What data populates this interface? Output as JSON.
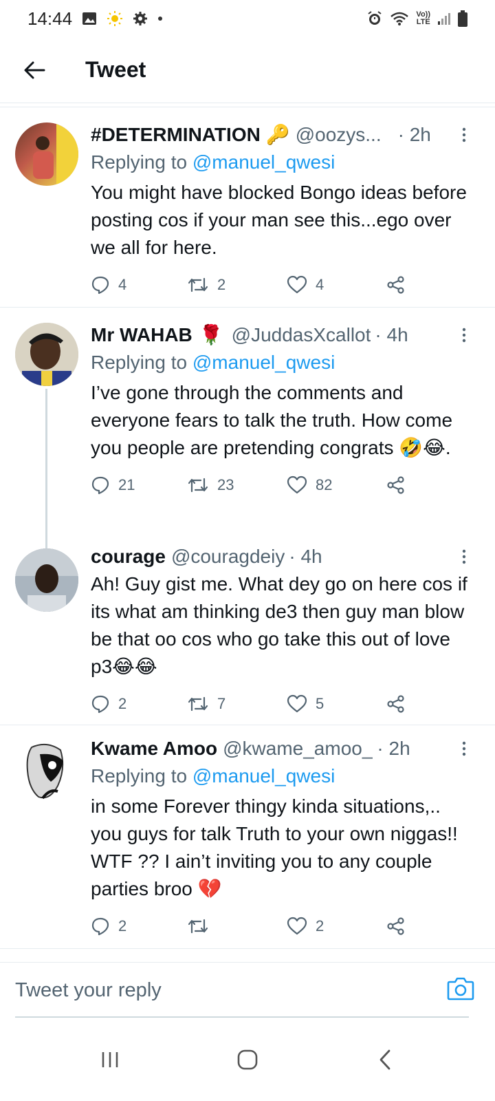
{
  "status_bar": {
    "time": "14:44",
    "icons_left": [
      "image-icon",
      "sun-icon",
      "gear-icon",
      "dot-icon"
    ],
    "icons_right": [
      "alarm-icon",
      "wifi-icon",
      "volte-icon",
      "signal-icon",
      "battery-icon"
    ],
    "volte_label_top": "Vo))",
    "volte_label_bottom": "LTE"
  },
  "header": {
    "title": "Tweet"
  },
  "tweets": [
    {
      "name": "#DETERMINATION",
      "name_emoji": "🔑",
      "handle": "@oozys...",
      "time": "· 2h",
      "replying_prefix": "Replying to ",
      "replying_to": "@manuel_qwesi",
      "text": "You might have blocked Bongo ideas before posting cos if your man see this...ego over we all for here.",
      "replies": "4",
      "retweets": "2",
      "likes": "4"
    },
    {
      "name": "Mr WAHAB",
      "name_emoji": "🌹",
      "handle": "@JuddasXcallot",
      "time": "· 4h",
      "replying_prefix": "Replying to ",
      "replying_to": "@manuel_qwesi",
      "text": "I’ve gone through the comments and everyone fears to talk the truth. How come you people are pretending congrats 🤣😂.",
      "replies": "21",
      "retweets": "23",
      "likes": "82"
    },
    {
      "name": "courage",
      "name_emoji": "",
      "handle": "@couragdeiy",
      "time": "· 4h",
      "text": "Ah! Guy gist me. What dey go on here cos if its what am thinking de3 then guy man blow be that oo cos who go take this out of love p3😂😂",
      "replies": "2",
      "retweets": "7",
      "likes": "5"
    },
    {
      "name": "Kwame Amoo",
      "name_emoji": "",
      "handle": "@kwame_amoo_",
      "time": "· 2h",
      "replying_prefix": "Replying to ",
      "replying_to": "@manuel_qwesi",
      "text": "in some Forever thingy kinda situations,.. you guys for talk Truth to your own niggas!! WTF ?? I ain’t inviting you to any couple parties broo 💔",
      "replies": "2",
      "retweets": "",
      "likes": "2"
    }
  ],
  "reply_bar": {
    "placeholder": "Tweet your reply"
  },
  "colors": {
    "accent": "#1d9bf0",
    "text": "#0f1419",
    "secondary": "#536471",
    "divider": "#e6ecf0"
  }
}
